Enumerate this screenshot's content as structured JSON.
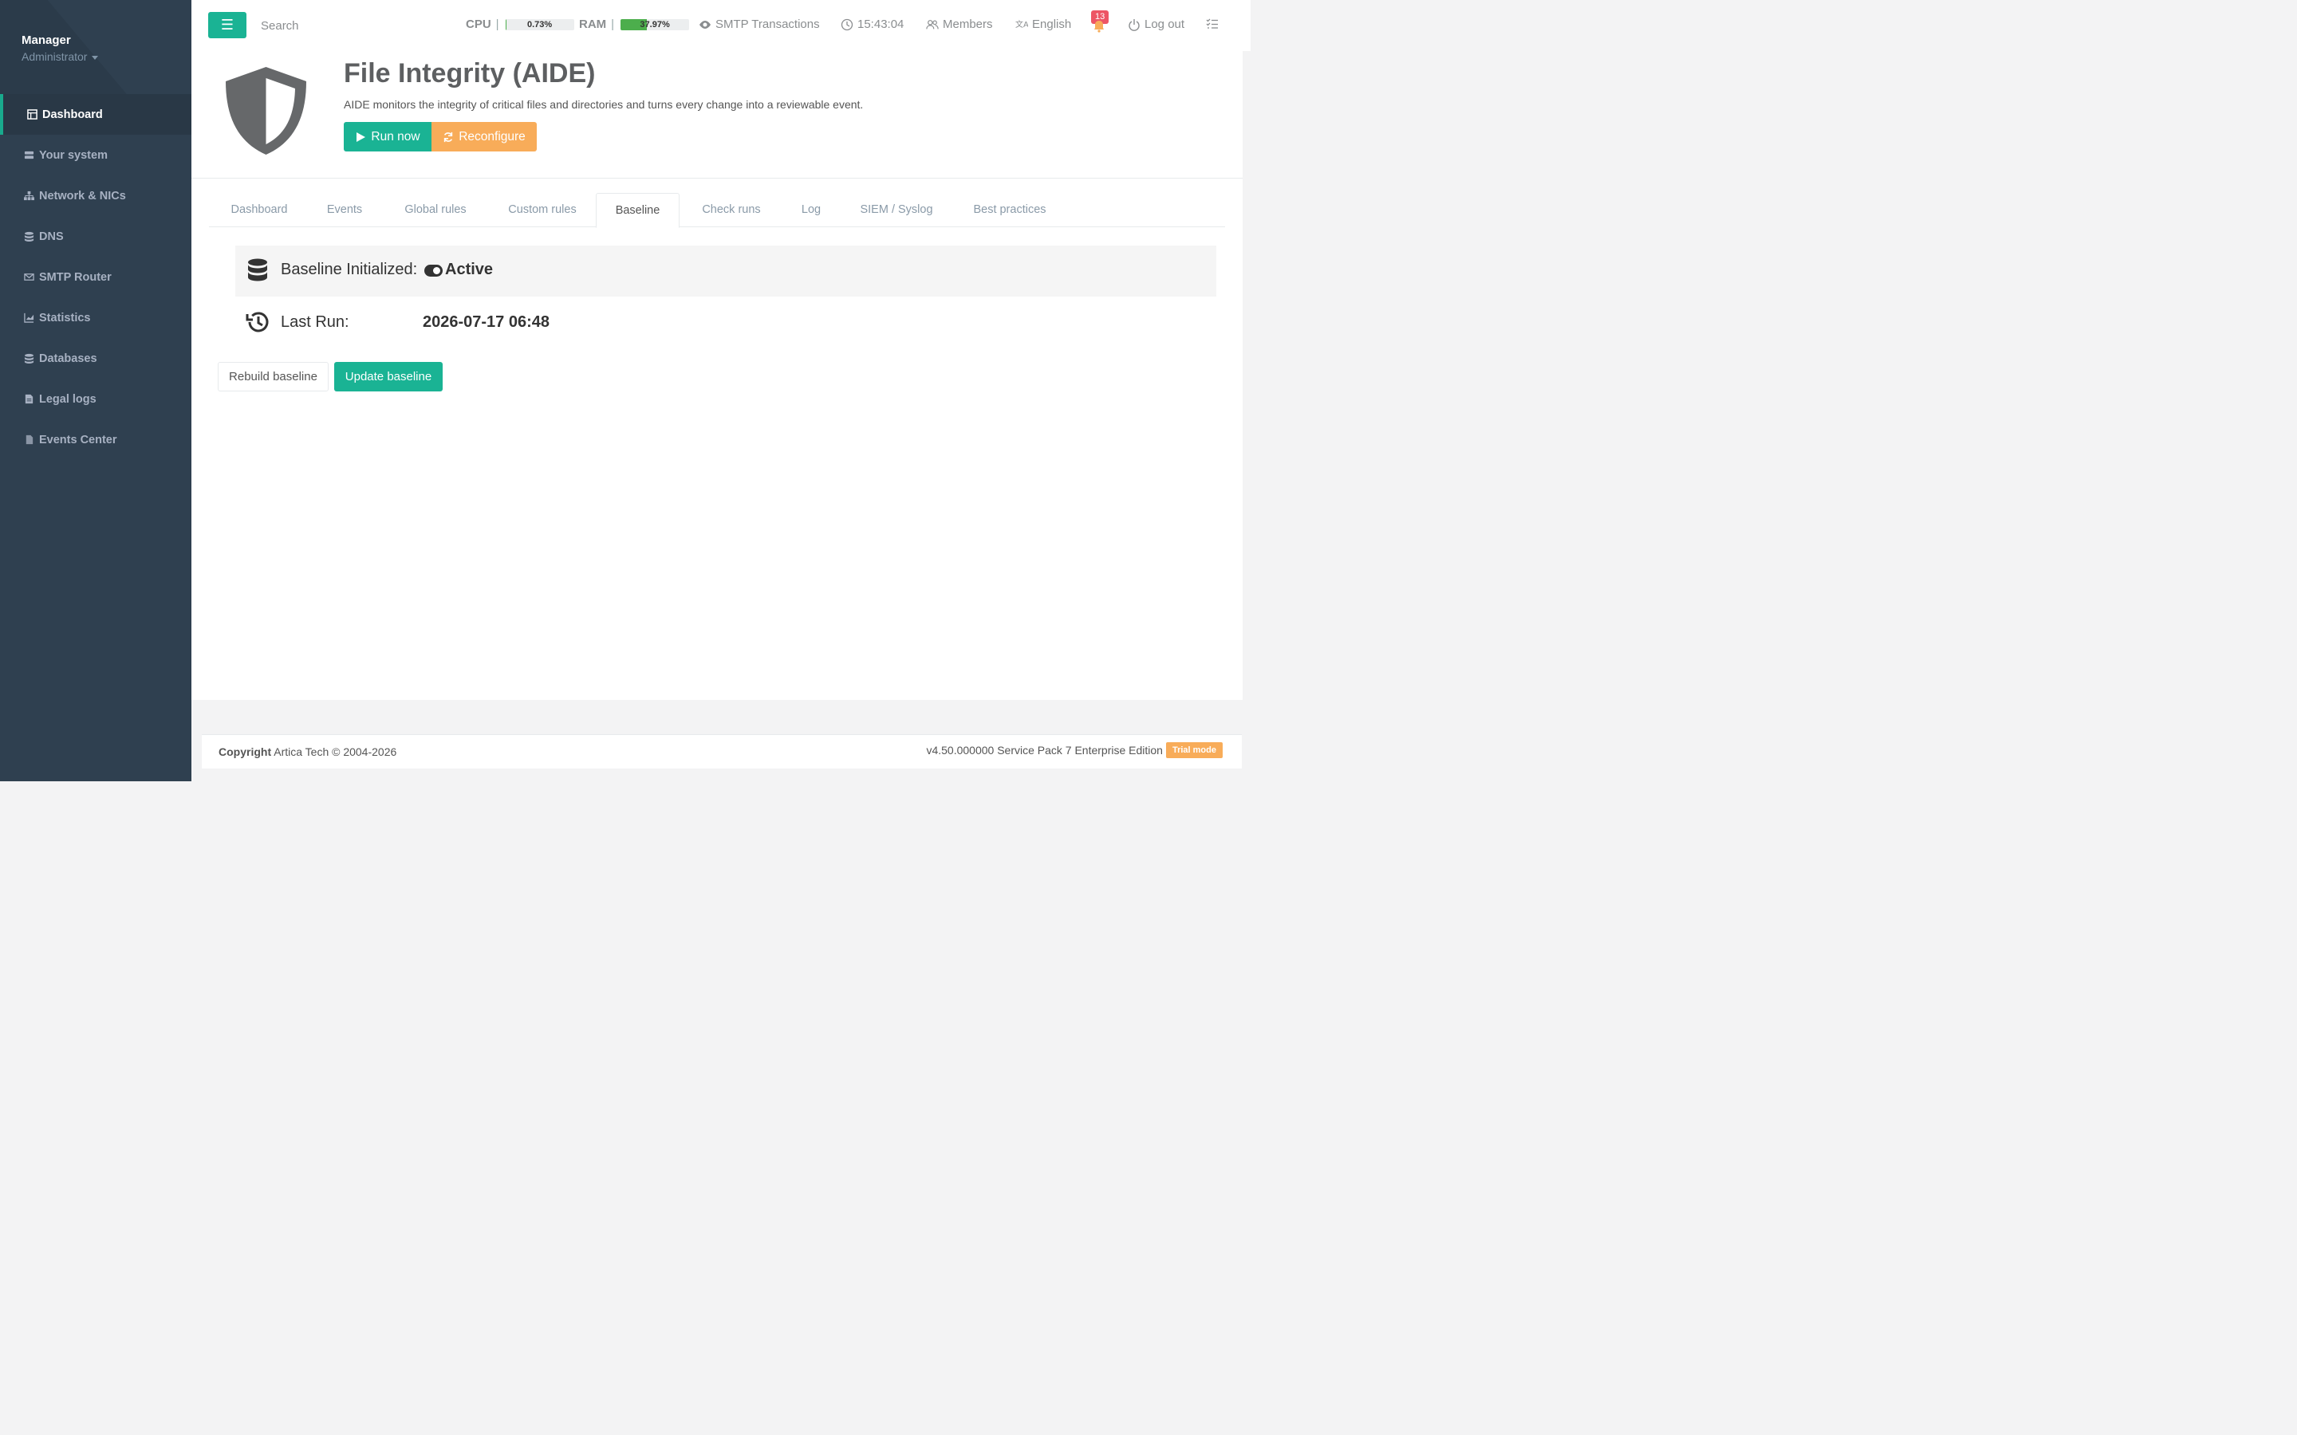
{
  "sidebar": {
    "profile": {
      "name": "Manager",
      "role": "Administrator"
    },
    "items": [
      {
        "label": "Dashboard",
        "icon": "dashboard-icon"
      },
      {
        "label": "Your system",
        "icon": "server-icon"
      },
      {
        "label": "Network & NICs",
        "icon": "network-icon"
      },
      {
        "label": "DNS",
        "icon": "database-icon"
      },
      {
        "label": "SMTP Router",
        "icon": "envelope-icon"
      },
      {
        "label": "Statistics",
        "icon": "chart-icon"
      },
      {
        "label": "Databases",
        "icon": "database-icon"
      },
      {
        "label": "Legal logs",
        "icon": "file-icon"
      },
      {
        "label": "Events Center",
        "icon": "file-icon"
      }
    ]
  },
  "topbar": {
    "search_placeholder": "Search",
    "cpu": {
      "label": "CPU",
      "value": "0.73%",
      "percent": 0.73
    },
    "ram": {
      "label": "RAM",
      "value": "37.97%",
      "percent": 37.97
    },
    "smtp": "SMTP Transactions",
    "time": "15:43:04",
    "members": "Members",
    "language": "English",
    "notifications": "13",
    "logout": "Log out"
  },
  "header": {
    "title": "File Integrity (AIDE)",
    "subtitle": "AIDE monitors the integrity of critical files and directories and turns every change into a reviewable event.",
    "run_label": "Run now",
    "reconfigure_label": "Reconfigure"
  },
  "tabs": [
    {
      "label": "Dashboard"
    },
    {
      "label": "Events"
    },
    {
      "label": "Global rules"
    },
    {
      "label": "Custom rules"
    },
    {
      "label": "Baseline"
    },
    {
      "label": "Check runs"
    },
    {
      "label": "Log"
    },
    {
      "label": "SIEM / Syslog"
    },
    {
      "label": "Best practices"
    }
  ],
  "baseline": {
    "initialized_label": "Baseline Initialized:",
    "initialized_value": "Active",
    "last_run_label": "Last Run:",
    "last_run_value": "2026-07-17 06:48",
    "rebuild_label": "Rebuild baseline",
    "update_label": "Update baseline"
  },
  "footer": {
    "copyright_bold": "Copyright",
    "copyright_text": "Artica Tech © 2004-2026",
    "version": "v4.50.000000 Service Pack 7 Enterprise Edition",
    "trial": "Trial mode"
  },
  "colors": {
    "accent": "#1ab394",
    "warning": "#f8ac59",
    "sidebar": "#2f4050",
    "danger": "#ed5565"
  }
}
